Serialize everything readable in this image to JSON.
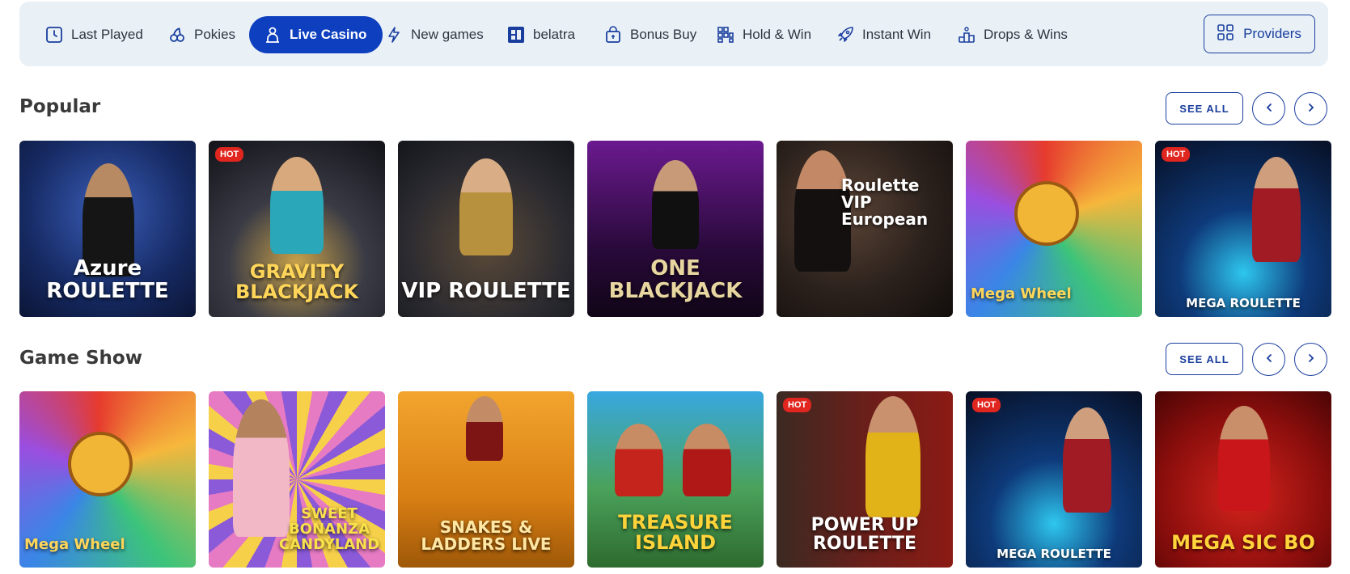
{
  "nav": {
    "items": [
      {
        "label": "Last Played",
        "icon": "clock-icon"
      },
      {
        "label": "Pokies",
        "icon": "cherries-icon"
      },
      {
        "label": "Live Casino",
        "icon": "dealer-icon",
        "active": true
      },
      {
        "label": "New games",
        "icon": "lightning-icon"
      },
      {
        "label": "belatra",
        "icon": "belatra-logo-icon"
      },
      {
        "label": "Bonus Buy",
        "icon": "gift-bag-icon"
      },
      {
        "label": "Hold & Win",
        "icon": "grid-dots-icon"
      },
      {
        "label": "Instant Win",
        "icon": "rocket-icon"
      },
      {
        "label": "Drops & Wins",
        "icon": "podium-icon"
      }
    ],
    "providers_label": "Providers"
  },
  "sections": [
    {
      "title": "Popular",
      "see_all": "SEE ALL",
      "games": [
        {
          "name": "Azure ROULETTE",
          "hot": false
        },
        {
          "name": "GRAVITY BLACKJACK",
          "hot": true,
          "badge": "HOT"
        },
        {
          "name": "VIP ROULETTE",
          "hot": false
        },
        {
          "name": "ONE BLACKJACK",
          "hot": false
        },
        {
          "name": "Roulette VIP European",
          "hot": false
        },
        {
          "name": "Mega Wheel",
          "hot": false
        },
        {
          "name": "MEGA ROULETTE",
          "hot": true,
          "badge": "HOT"
        }
      ]
    },
    {
      "title": "Game Show",
      "see_all": "SEE ALL",
      "games": [
        {
          "name": "Mega Wheel",
          "hot": false
        },
        {
          "name": "SWEET BONANZA CANDYLAND",
          "hot": false
        },
        {
          "name": "SNAKES & LADDERS LIVE",
          "hot": false
        },
        {
          "name": "TREASURE ISLAND",
          "hot": false
        },
        {
          "name": "POWER UP ROULETTE",
          "hot": true,
          "badge": "HOT"
        },
        {
          "name": "MEGA ROULETTE",
          "hot": true,
          "badge": "HOT"
        },
        {
          "name": "MEGA SIC BO",
          "hot": false
        }
      ]
    }
  ],
  "colors": {
    "accent": "#0d3fbf",
    "nav_bg": "#e9f1f7",
    "hot_badge": "#e0261f"
  }
}
